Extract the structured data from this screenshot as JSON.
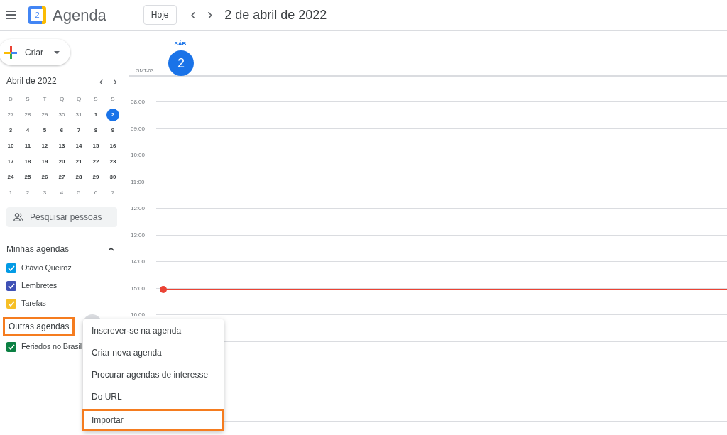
{
  "header": {
    "app_name": "Agenda",
    "logo_day": "2",
    "today_button": "Hoje",
    "prev": "‹",
    "next": "›",
    "date_title": "2 de abril de 2022"
  },
  "create_button": {
    "label": "Criar"
  },
  "mini_calendar": {
    "title": "Abril de 2022",
    "prev": "‹",
    "next": "›",
    "weekdays": [
      "D",
      "S",
      "T",
      "Q",
      "Q",
      "S",
      "S"
    ],
    "days": [
      {
        "label": "27",
        "outside": true,
        "selected": false
      },
      {
        "label": "28",
        "outside": true,
        "selected": false
      },
      {
        "label": "29",
        "outside": true,
        "selected": false
      },
      {
        "label": "30",
        "outside": true,
        "selected": false
      },
      {
        "label": "31",
        "outside": true,
        "selected": false
      },
      {
        "label": "1",
        "outside": false,
        "selected": false
      },
      {
        "label": "2",
        "outside": false,
        "selected": true
      },
      {
        "label": "3",
        "outside": false,
        "selected": false
      },
      {
        "label": "4",
        "outside": false,
        "selected": false
      },
      {
        "label": "5",
        "outside": false,
        "selected": false
      },
      {
        "label": "6",
        "outside": false,
        "selected": false
      },
      {
        "label": "7",
        "outside": false,
        "selected": false
      },
      {
        "label": "8",
        "outside": false,
        "selected": false
      },
      {
        "label": "9",
        "outside": false,
        "selected": false
      },
      {
        "label": "10",
        "outside": false,
        "selected": false
      },
      {
        "label": "11",
        "outside": false,
        "selected": false
      },
      {
        "label": "12",
        "outside": false,
        "selected": false
      },
      {
        "label": "13",
        "outside": false,
        "selected": false
      },
      {
        "label": "14",
        "outside": false,
        "selected": false
      },
      {
        "label": "15",
        "outside": false,
        "selected": false
      },
      {
        "label": "16",
        "outside": false,
        "selected": false
      },
      {
        "label": "17",
        "outside": false,
        "selected": false
      },
      {
        "label": "18",
        "outside": false,
        "selected": false
      },
      {
        "label": "19",
        "outside": false,
        "selected": false
      },
      {
        "label": "20",
        "outside": false,
        "selected": false
      },
      {
        "label": "21",
        "outside": false,
        "selected": false
      },
      {
        "label": "22",
        "outside": false,
        "selected": false
      },
      {
        "label": "23",
        "outside": false,
        "selected": false
      },
      {
        "label": "24",
        "outside": false,
        "selected": false
      },
      {
        "label": "25",
        "outside": false,
        "selected": false
      },
      {
        "label": "26",
        "outside": false,
        "selected": false
      },
      {
        "label": "27",
        "outside": false,
        "selected": false
      },
      {
        "label": "28",
        "outside": false,
        "selected": false
      },
      {
        "label": "29",
        "outside": false,
        "selected": false
      },
      {
        "label": "30",
        "outside": false,
        "selected": false
      },
      {
        "label": "1",
        "outside": true,
        "selected": false
      },
      {
        "label": "2",
        "outside": true,
        "selected": false
      },
      {
        "label": "3",
        "outside": true,
        "selected": false
      },
      {
        "label": "4",
        "outside": true,
        "selected": false
      },
      {
        "label": "5",
        "outside": true,
        "selected": false
      },
      {
        "label": "6",
        "outside": true,
        "selected": false
      },
      {
        "label": "7",
        "outside": true,
        "selected": false
      }
    ]
  },
  "search_people": {
    "placeholder": "Pesquisar pessoas"
  },
  "my_calendars": {
    "title": "Minhas agendas",
    "expanded": true,
    "items": [
      {
        "label": "Otávio Queiroz",
        "checked": true,
        "color": "#039be5"
      },
      {
        "label": "Lembretes",
        "checked": true,
        "color": "#3f51b5"
      },
      {
        "label": "Tarefas",
        "checked": true,
        "color": "#f6bf26"
      }
    ]
  },
  "other_calendars": {
    "title": "Outras agendas",
    "highlighted": true,
    "items": [
      {
        "label": "Feriados no Brasil",
        "checked": true,
        "color": "#0b8043"
      }
    ]
  },
  "day_header": {
    "weekday": "SÁB.",
    "day": "2",
    "timezone": "GMT-03"
  },
  "hours": [
    "08:00",
    "09:00",
    "10:00",
    "11:00",
    "12:00",
    "13:00",
    "14:00",
    "15:00",
    "16:00"
  ],
  "menu": {
    "items": [
      {
        "label": "Inscrever-se na agenda",
        "highlighted": false
      },
      {
        "label": "Criar nova agenda",
        "highlighted": false
      },
      {
        "label": "Procurar agendas de interesse",
        "highlighted": false
      },
      {
        "label": "Do URL",
        "highlighted": false
      },
      {
        "label": "Importar",
        "highlighted": true
      }
    ]
  }
}
